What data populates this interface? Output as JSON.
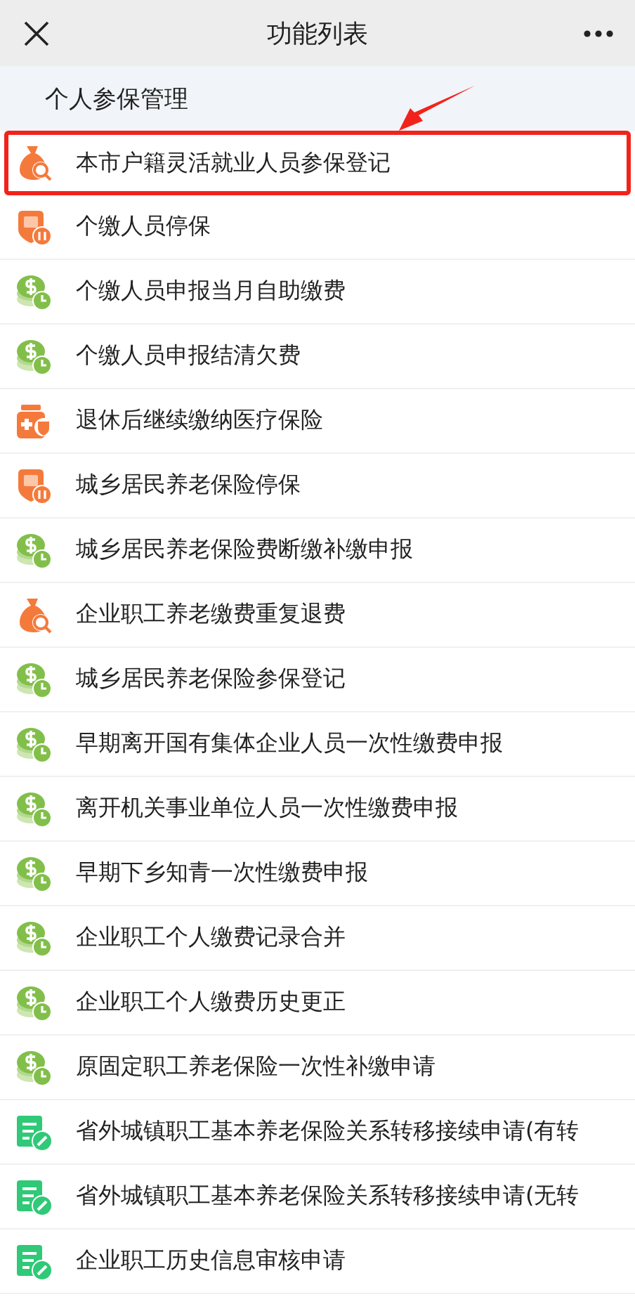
{
  "window": {
    "title": "功能列表"
  },
  "section": {
    "title": "个人参保管理"
  },
  "items": [
    {
      "label": "本市户籍灵活就业人员参保登记",
      "kind": "bag",
      "highlighted": true
    },
    {
      "label": "个缴人员停保",
      "kind": "pause",
      "highlighted": false
    },
    {
      "label": "个缴人员申报当月自助缴费",
      "kind": "coins",
      "highlighted": false
    },
    {
      "label": "个缴人员申报结清欠费",
      "kind": "coins",
      "highlighted": false
    },
    {
      "label": "退休后继续缴纳医疗保险",
      "kind": "medicine",
      "highlighted": false
    },
    {
      "label": "城乡居民养老保险停保",
      "kind": "pause",
      "highlighted": false
    },
    {
      "label": "城乡居民养老保险费断缴补缴申报",
      "kind": "coins",
      "highlighted": false
    },
    {
      "label": "企业职工养老缴费重复退费",
      "kind": "bag",
      "highlighted": false
    },
    {
      "label": "城乡居民养老保险参保登记",
      "kind": "coins",
      "highlighted": false
    },
    {
      "label": "早期离开国有集体企业人员一次性缴费申报",
      "kind": "coins",
      "highlighted": false
    },
    {
      "label": "离开机关事业单位人员一次性缴费申报",
      "kind": "coins",
      "highlighted": false
    },
    {
      "label": "早期下乡知青一次性缴费申报",
      "kind": "coins",
      "highlighted": false
    },
    {
      "label": "企业职工个人缴费记录合并",
      "kind": "coins",
      "highlighted": false
    },
    {
      "label": "企业职工个人缴费历史更正",
      "kind": "coins",
      "highlighted": false
    },
    {
      "label": "原固定职工养老保险一次性补缴申请",
      "kind": "coins",
      "highlighted": false
    },
    {
      "label": "省外城镇职工基本养老保险关系转移接续申请(有转",
      "kind": "form",
      "highlighted": false
    },
    {
      "label": "省外城镇职工基本养老保险关系转移接续申请(无转",
      "kind": "form",
      "highlighted": false
    },
    {
      "label": "企业职工历史信息审核申请",
      "kind": "form",
      "highlighted": false
    }
  ]
}
